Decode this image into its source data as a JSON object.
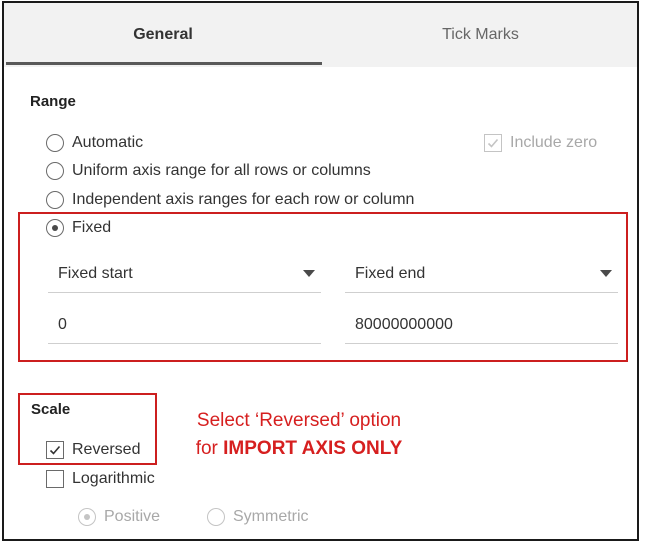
{
  "tabs": {
    "general": "General",
    "tick_marks": "Tick Marks",
    "active": "General"
  },
  "range": {
    "title": "Range",
    "options": [
      {
        "label": "Automatic",
        "checked": false
      },
      {
        "label": "Uniform axis range for all rows or columns",
        "checked": false
      },
      {
        "label": "Independent axis ranges for each row or column",
        "checked": false
      },
      {
        "label": "Fixed",
        "checked": true
      }
    ],
    "include_zero": {
      "label": "Include zero",
      "checked": true,
      "disabled": true
    },
    "fixed_start": {
      "label": "Fixed start",
      "value": "0"
    },
    "fixed_end": {
      "label": "Fixed end",
      "value": "80000000000"
    }
  },
  "scale": {
    "title": "Scale",
    "reversed": {
      "label": "Reversed",
      "checked": true
    },
    "logarithmic": {
      "label": "Logarithmic",
      "checked": false
    },
    "positive": {
      "label": "Positive",
      "checked": true,
      "disabled": true
    },
    "symmetric": {
      "label": "Symmetric",
      "checked": false,
      "disabled": true
    }
  },
  "annotation": {
    "line1": "Select ‘Reversed’ option",
    "line2_prefix": "for ",
    "line2_bold": "IMPORT AXIS ONLY"
  },
  "colors": {
    "annotation_red": "#d61f1f",
    "tab_background": "#f2f2f2",
    "active_underline": "#595959"
  },
  "icons": {
    "checkmark": "check-icon",
    "dropdown": "caret-down-icon"
  }
}
